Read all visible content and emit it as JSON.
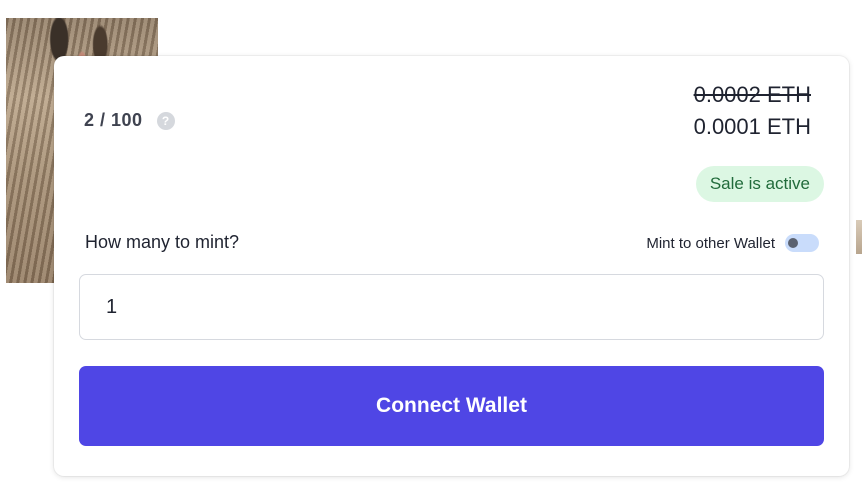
{
  "mint": {
    "supply_text": "2 / 100",
    "help_glyph": "?",
    "price_original": "0.0002 ETH",
    "price_current": "0.0001 ETH",
    "sale_status": "Sale is active",
    "quantity_label": "How many to mint?",
    "other_wallet_label": "Mint to other Wallet",
    "other_wallet_enabled": false,
    "quantity_value": "1",
    "connect_label": "Connect Wallet"
  },
  "colors": {
    "accent": "#4f46e5",
    "status_bg": "#dcf7e3",
    "status_text": "#216b3b",
    "toggle_track": "#c9dcfb"
  },
  "icons": {
    "help": "question-circle-icon"
  }
}
